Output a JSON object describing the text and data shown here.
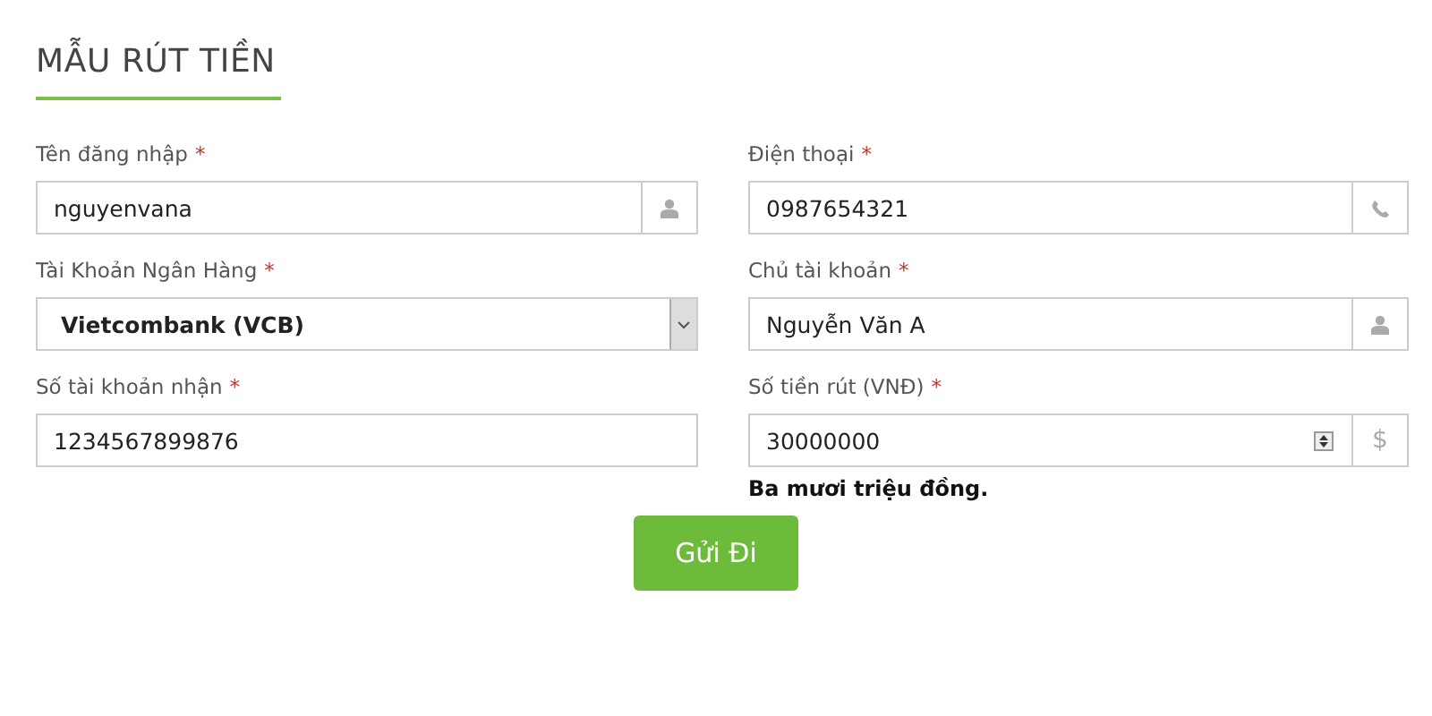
{
  "title": "MẪU RÚT TIỀN",
  "fields": [
    {
      "label": "Tên đăng nhập",
      "mark": "*",
      "kind": "user",
      "value": "nguyenvana"
    },
    {
      "label": "Điện thoại",
      "mark": "*",
      "kind": "phone",
      "value": "0987654321"
    },
    {
      "label": "Tài Khoản Ngân Hàng",
      "mark": "*",
      "kind": "select",
      "value": "Vietcombank (VCB)"
    },
    {
      "label": "Chủ tài khoản",
      "mark": "*",
      "kind": "user",
      "value": "Nguyễn Văn A"
    },
    {
      "label": "Số tài khoản nhận",
      "mark": "*",
      "kind": "plain",
      "value": "1234567899876"
    },
    {
      "label": "Số tiền rút (VNĐ)",
      "mark": "*",
      "kind": "money",
      "value": "30000000",
      "addon": "$",
      "hint": "Ba mươi triệu đồng."
    }
  ],
  "submit": "Gửi Đi"
}
